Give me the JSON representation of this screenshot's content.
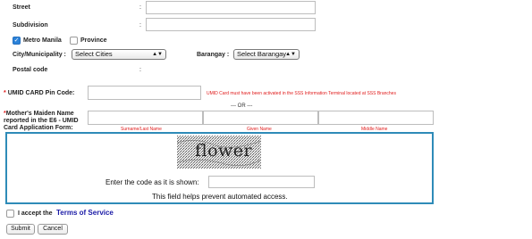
{
  "address": {
    "street_label": "Street",
    "subdivision_label": "Subdivision",
    "colon": ":",
    "metro_manila_label": "Metro Manila",
    "province_label": "Province",
    "city_label": "City/Municipality :",
    "city_value": "Select Cities",
    "barangay_label": "Barangay :",
    "barangay_value": "Select Barangay",
    "postal_label": "Postal code"
  },
  "umid": {
    "pin_label": "UMID CARD Pin Code:",
    "pin_required": "*",
    "pin_note": "UMID Card must have been activated in the SSS Information Terminal located at SSS Branches",
    "or_text": "--- OR ---",
    "maiden_required": "*",
    "maiden_line1": "Mother's Maiden Name",
    "maiden_line2": "reported in the E6 - UMID",
    "maiden_line3": "Card Application Form:",
    "surname_label": "Surname/Last Name",
    "given_label": "Given Name",
    "middle_label": "Middle Name"
  },
  "captcha": {
    "word": "flower",
    "prompt": "Enter the code as it is shown:",
    "help": "This field helps prevent automated access."
  },
  "terms": {
    "accept_label": "I accept the",
    "link_label": "Terms of Service"
  },
  "buttons": {
    "submit": "Submit",
    "cancel": "Cancel"
  },
  "colors": {
    "accent_blue": "#2e8bb8",
    "link_blue": "#1a1aa6",
    "required_red": "#e01b1b"
  }
}
